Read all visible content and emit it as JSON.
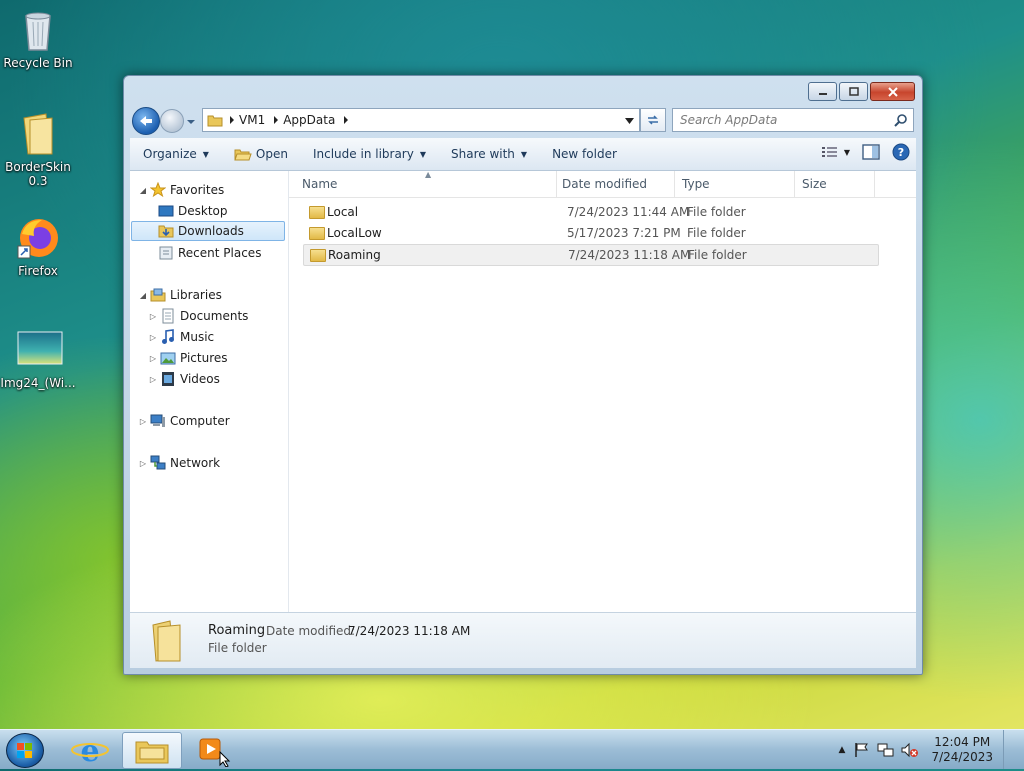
{
  "desktop": {
    "icons": [
      {
        "label": "Recycle Bin"
      },
      {
        "label": "BorderSkin 0.3"
      },
      {
        "label": "Firefox"
      },
      {
        "label": "Img24_(Wi..."
      }
    ]
  },
  "window": {
    "address": {
      "crumbs": [
        "VM1",
        "AppData"
      ]
    },
    "search": {
      "placeholder": "Search AppData"
    },
    "toolbar": {
      "organize": "Organize",
      "open": "Open",
      "include_in_library": "Include in library",
      "share_with": "Share with",
      "new_folder": "New folder"
    },
    "nav": {
      "favorites": "Favorites",
      "desktop": "Desktop",
      "downloads": "Downloads",
      "recent_places": "Recent Places",
      "libraries": "Libraries",
      "documents": "Documents",
      "music": "Music",
      "pictures": "Pictures",
      "videos": "Videos",
      "computer": "Computer",
      "network": "Network"
    },
    "columns": {
      "name": "Name",
      "date_modified": "Date modified",
      "type": "Type",
      "size": "Size"
    },
    "files": [
      {
        "name": "Local",
        "date": "7/24/2023 11:44 AM",
        "type": "File folder"
      },
      {
        "name": "LocalLow",
        "date": "5/17/2023 7:21 PM",
        "type": "File folder"
      },
      {
        "name": "Roaming",
        "date": "7/24/2023 11:18 AM",
        "type": "File folder"
      }
    ],
    "details": {
      "name": "Roaming",
      "date_label": "Date modified:",
      "date_value": "7/24/2023 11:18 AM",
      "type": "File folder"
    }
  },
  "taskbar": {
    "time": "12:04 PM",
    "date": "7/24/2023"
  },
  "colors": {
    "accent": "#1d5fb0",
    "selection": "#cfe6fa",
    "close_button": "#c7452d"
  }
}
